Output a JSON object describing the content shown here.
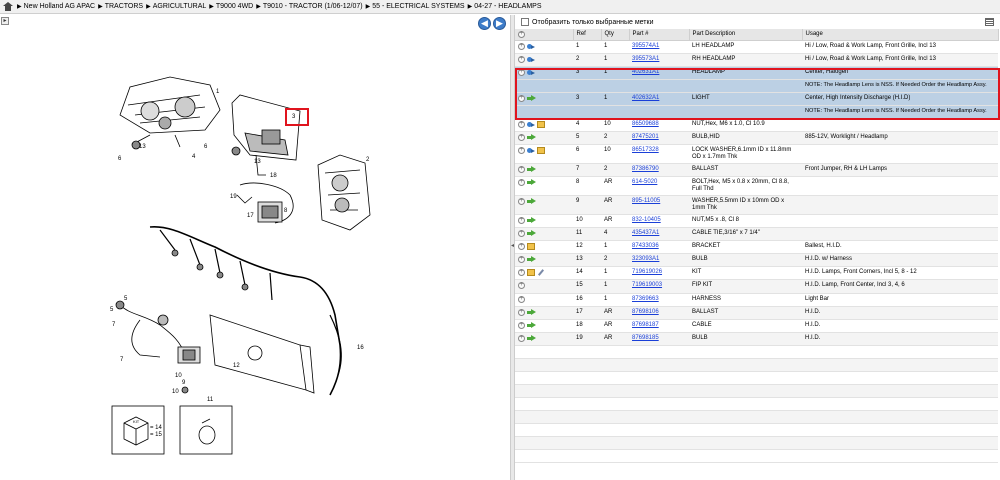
{
  "breadcrumb": [
    "New Holland AG APAC",
    "TRACTORS",
    "AGRICULTURAL",
    "T9000 4WD",
    "T9010 - TRACTOR (1/06-12/07)",
    "55 - ELECTRICAL SYSTEMS",
    "04-27 - HEADLAMPS"
  ],
  "left": {
    "collapse_glyph": "▸",
    "nav_prev": "◀",
    "nav_next": "▶"
  },
  "diagram_labels": {
    "n1": "1",
    "n2": "2",
    "n3": "3",
    "n4": "4",
    "n5": "5",
    "n6": "6",
    "n7": "7",
    "n8": "8",
    "n9": "9",
    "n10": "10",
    "n11": "11",
    "n12": "12",
    "n13": "13",
    "n14": "14",
    "n15": "15",
    "n16": "16",
    "n17": "17",
    "n18": "18",
    "n19": "19",
    "kit_label": "KIT",
    "kit_14": "= 14",
    "kit_15": "= 15",
    "n11b": "11",
    "n13b": "13",
    "n5b": "5",
    "n7b": "7",
    "n10b": "10",
    "n6b": "6",
    "n16b": "16"
  },
  "filter": {
    "label": "Отобразить только выбранные метки"
  },
  "columns": [
    "",
    "Ref",
    "Qty",
    "Part #",
    "Part Description",
    "Usage"
  ],
  "rows": [
    {
      "ref": "1",
      "qty": "1",
      "part": "395574A1",
      "desc": "LH HEADLAMP",
      "usage": "Hi / Low, Road & Work Lamp, Front Grille, Incl 13",
      "icons": [
        "plus",
        "blue"
      ]
    },
    {
      "ref": "2",
      "qty": "1",
      "part": "395573A1",
      "desc": "RH HEADLAMP",
      "usage": "Hi / Low, Road & Work Lamp, Front Grille, Incl 13",
      "icons": [
        "plus",
        "blue"
      ]
    },
    {
      "ref": "3",
      "qty": "1",
      "part": "402631A1",
      "desc": "HEADLAMP",
      "usage": "Center, Halogen",
      "note": "NOTE: The Headlamp Lens is NSS. If Needed Order the Headlamp Assy.",
      "icons": [
        "plus",
        "blue"
      ],
      "selected": true
    },
    {
      "ref": "3",
      "qty": "1",
      "part": "402632A1",
      "desc": "LIGHT",
      "usage": "Center, High Intensity Discharge (H.I.D)",
      "note": "NOTE: The Headlamp Lens is NSS. If Needed Order the Headlamp Assy.",
      "icons": [
        "plus",
        "green"
      ],
      "selected": true
    },
    {
      "ref": "4",
      "qty": "10",
      "part": "86509688",
      "desc": "NUT,Hex, M6 x 1.0, Cl 10.9",
      "usage": "",
      "icons": [
        "plus",
        "blue",
        "box"
      ]
    },
    {
      "ref": "5",
      "qty": "2",
      "part": "87475201",
      "desc": "BULB,HID",
      "usage": "885-12V, Worklight / Headlamp",
      "icons": [
        "plus",
        "green"
      ]
    },
    {
      "ref": "6",
      "qty": "10",
      "part": "86517328",
      "desc": "LOCK WASHER,6.1mm ID x 11.8mm OD x 1.7mm Thk",
      "usage": "",
      "icons": [
        "plus",
        "blue",
        "box"
      ]
    },
    {
      "ref": "7",
      "qty": "2",
      "part": "87386790",
      "desc": "BALLAST",
      "usage": "Front Jumper, RH & LH Lamps",
      "icons": [
        "plus",
        "green"
      ]
    },
    {
      "ref": "8",
      "qty": "AR",
      "part": "614-5020",
      "desc": "BOLT,Hex, M5 x 0.8 x 20mm, Cl 8.8, Full Thd",
      "usage": "",
      "icons": [
        "plus",
        "green"
      ]
    },
    {
      "ref": "9",
      "qty": "AR",
      "part": "895-11005",
      "desc": "WASHER,5.5mm ID x 10mm OD x 1mm Thk",
      "usage": "",
      "icons": [
        "plus",
        "green"
      ]
    },
    {
      "ref": "10",
      "qty": "AR",
      "part": "832-10405",
      "desc": "NUT,M5 x .8, Cl 8",
      "usage": "",
      "icons": [
        "plus",
        "green"
      ]
    },
    {
      "ref": "11",
      "qty": "4",
      "part": "435437A1",
      "desc": "CABLE TIE,3/16\" x 7 1/4\"",
      "usage": "",
      "icons": [
        "plus",
        "green"
      ]
    },
    {
      "ref": "12",
      "qty": "1",
      "part": "87433036",
      "desc": "BRACKET",
      "usage": "Ballest, H.I.D.",
      "icons": [
        "plus",
        "box"
      ]
    },
    {
      "ref": "13",
      "qty": "2",
      "part": "323093A1",
      "desc": "BULB",
      "usage": "H.I.D. w/ Harness",
      "icons": [
        "plus",
        "green"
      ]
    },
    {
      "ref": "14",
      "qty": "1",
      "part": "719619026",
      "desc": "KIT",
      "usage": "H.I.D. Lamps, Front Corners, Incl 5, 8 - 12",
      "icons": [
        "plus",
        "box",
        "wrench"
      ]
    },
    {
      "ref": "15",
      "qty": "1",
      "part": "719619003",
      "desc": "FIP KIT",
      "usage": "H.I.D. Lamp, Front Center, Incl 3, 4, 6",
      "icons": [
        "plus"
      ]
    },
    {
      "ref": "16",
      "qty": "1",
      "part": "87369663",
      "desc": "HARNESS",
      "usage": "Light Bar",
      "icons": [
        "plus"
      ]
    },
    {
      "ref": "17",
      "qty": "AR",
      "part": "87698106",
      "desc": "BALLAST",
      "usage": "H.I.D.",
      "icons": [
        "plus",
        "green"
      ]
    },
    {
      "ref": "18",
      "qty": "AR",
      "part": "87698187",
      "desc": "CABLE",
      "usage": "H.I.D.",
      "icons": [
        "plus",
        "green"
      ]
    },
    {
      "ref": "19",
      "qty": "AR",
      "part": "87698185",
      "desc": "BULB",
      "usage": "H.I.D.",
      "icons": [
        "plus",
        "green"
      ]
    }
  ],
  "colors": {
    "selection": "#bcd0e4",
    "highlight_border": "#e0141e",
    "link": "#1a3fd8"
  }
}
